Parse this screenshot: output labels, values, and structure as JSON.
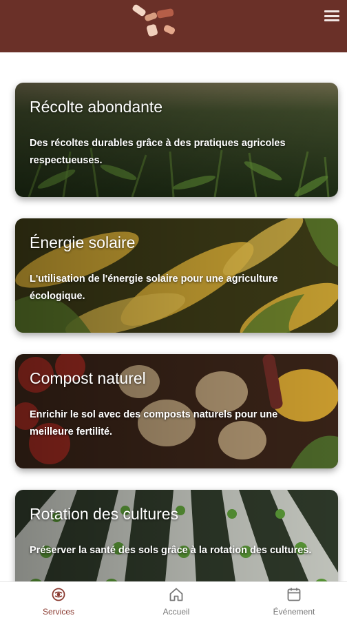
{
  "colors": {
    "header_bg": "#6a3028",
    "active_nav": "#8a3a30",
    "inactive_nav": "#777777"
  },
  "header": {
    "logo_icon": "hands-logo-icon",
    "menu_icon": "hamburger-menu-icon"
  },
  "cards": [
    {
      "title": "Récolte abondante",
      "description": "Des récoltes durables grâce à des pratiques agricoles respectueuses.",
      "image": "cornfield-sunset"
    },
    {
      "title": "Énergie solaire",
      "description": "L'utilisation de l'énergie solaire pour une agriculture écologique.",
      "image": "corn-cobs"
    },
    {
      "title": "Compost naturel",
      "description": "Enrichir le sol avec des composts naturels pour une meilleure fertilité.",
      "image": "vegetables"
    },
    {
      "title": "Rotation des cultures",
      "description": "Préserver la santé des sols grâce à la rotation des cultures.",
      "image": "hydroponic-rows"
    }
  ],
  "nav": [
    {
      "label": "Services",
      "icon": "services-icon",
      "active": true
    },
    {
      "label": "Accueil",
      "icon": "home-icon",
      "active": false
    },
    {
      "label": "Événement",
      "icon": "calendar-icon",
      "active": false
    }
  ]
}
